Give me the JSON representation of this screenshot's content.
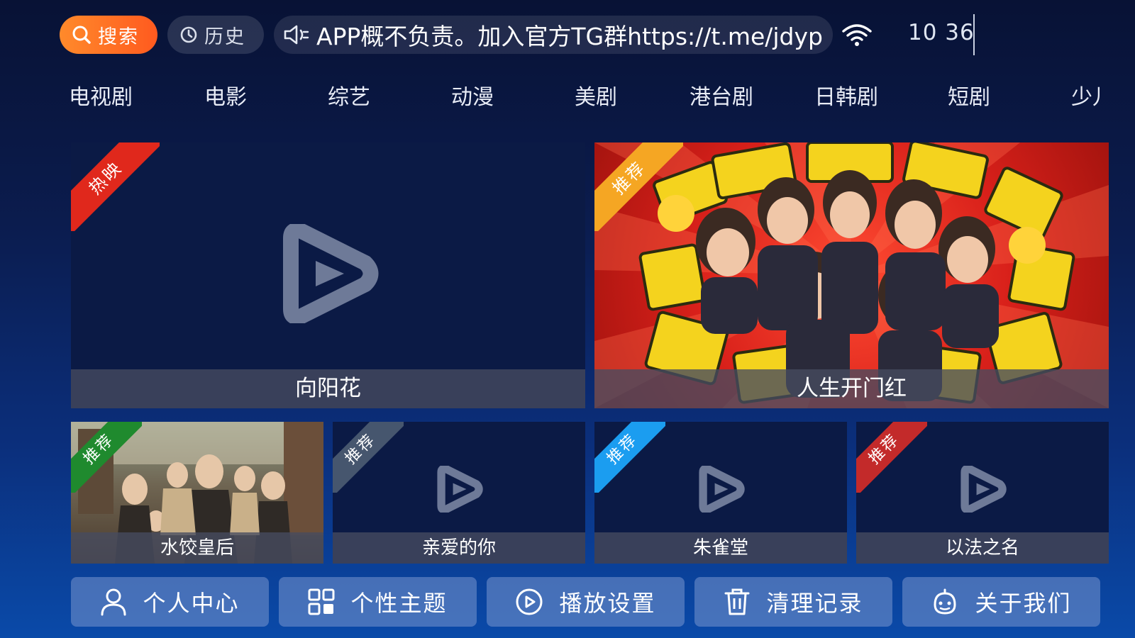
{
  "topbar": {
    "search_label": "搜索",
    "history_label": "历史",
    "notice_text": "APP概不负责。加入官方TG群https://t.me/jdyp",
    "time": "10 36"
  },
  "nav": {
    "items": [
      "电视剧",
      "电影",
      "综艺",
      "动漫",
      "美剧",
      "港台剧",
      "日韩剧",
      "短剧",
      "少儿"
    ]
  },
  "featured": [
    {
      "title": "向阳花",
      "badge": "热映",
      "badge_color": "#e0281c"
    },
    {
      "title": "人生开门红",
      "badge": "推荐",
      "badge_color": "#f5a623"
    }
  ],
  "recommended": [
    {
      "title": "水饺皇后",
      "badge": "推荐",
      "badge_color": "#1f8a2e"
    },
    {
      "title": "亲爱的你",
      "badge": "推荐",
      "badge_color": "#46566e"
    },
    {
      "title": "朱雀堂",
      "badge": "推荐",
      "badge_color": "#1b9df0"
    },
    {
      "title": "以法之名",
      "badge": "推荐",
      "badge_color": "#c32a2a"
    }
  ],
  "bottom_menu": [
    {
      "label": "个人中心",
      "icon": "user-icon"
    },
    {
      "label": "个性主题",
      "icon": "grid-icon"
    },
    {
      "label": "播放设置",
      "icon": "play-circle-icon"
    },
    {
      "label": "清理记录",
      "icon": "trash-icon"
    },
    {
      "label": "关于我们",
      "icon": "robot-icon"
    }
  ],
  "colors": {
    "accent": "#ff6a24",
    "background_top": "#081235",
    "background_bottom": "#0a4aa9"
  }
}
